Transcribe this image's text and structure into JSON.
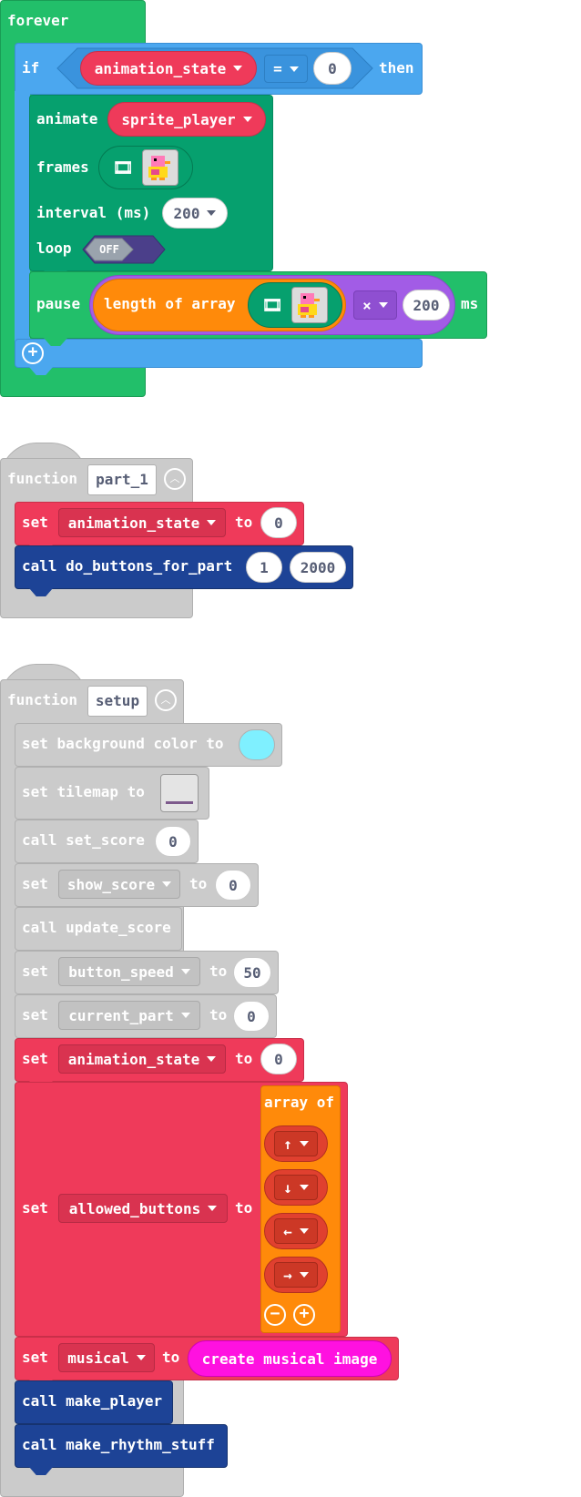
{
  "forever_block": {
    "label": "forever",
    "if_label": "if",
    "then_label": "then",
    "condition": {
      "variable": "animation_state",
      "operator": "=",
      "value": "0"
    },
    "animate": {
      "label": "animate",
      "sprite": "sprite_player",
      "frames_label": "frames",
      "interval_label": "interval (ms)",
      "interval_value": "200",
      "loop_label": "loop",
      "loop_toggle": "OFF"
    },
    "pause": {
      "label": "pause",
      "length_label": "length of array",
      "operator": "×",
      "value": "200",
      "unit": "ms"
    }
  },
  "function_part1": {
    "label": "function",
    "name": "part_1",
    "set_block": {
      "set_label": "set",
      "variable": "animation_state",
      "to_label": "to",
      "value": "0"
    },
    "call_block": {
      "call_label": "call",
      "function": "do_buttons_for_part",
      "arg1": "1",
      "arg2": "2000"
    }
  },
  "function_setup": {
    "label": "function",
    "name": "setup",
    "background": {
      "text": "set background color to",
      "color": "#7ff0ff"
    },
    "tilemap": {
      "text": "set tilemap to"
    },
    "set_score": {
      "text": "call set_score",
      "value": "0"
    },
    "show_score": {
      "set_label": "set",
      "variable": "show_score",
      "to_label": "to",
      "value": "0"
    },
    "update_score": {
      "text": "call update_score"
    },
    "button_speed": {
      "set_label": "set",
      "variable": "button_speed",
      "to_label": "to",
      "value": "50"
    },
    "current_part": {
      "set_label": "set",
      "variable": "current_part",
      "to_label": "to",
      "value": "0"
    },
    "animation_state": {
      "set_label": "set",
      "variable": "animation_state",
      "to_label": "to",
      "value": "0"
    },
    "allowed_buttons": {
      "set_label": "set",
      "variable": "allowed_buttons",
      "to_label": "to",
      "array_label": "array of",
      "items": [
        "↑",
        "↓",
        "←",
        "→"
      ]
    },
    "musical": {
      "set_label": "set",
      "variable": "musical",
      "to_label": "to",
      "value": "create musical image"
    },
    "make_player": {
      "text": "call make_player"
    },
    "make_rhythm": {
      "text": "call make_rhythm_stuff"
    }
  },
  "colors": {
    "loops_green": "#22bf6a",
    "logic_blue": "#4ba7ef",
    "animation_green": "#06a06e",
    "variables_red": "#ef3a5a",
    "functions_dark_blue": "#1d4396",
    "disabled_grey": "#cbcbcb",
    "array_orange": "#ff8a0a",
    "math_purple": "#a25ce6",
    "image_magenta": "#ff11e0"
  }
}
